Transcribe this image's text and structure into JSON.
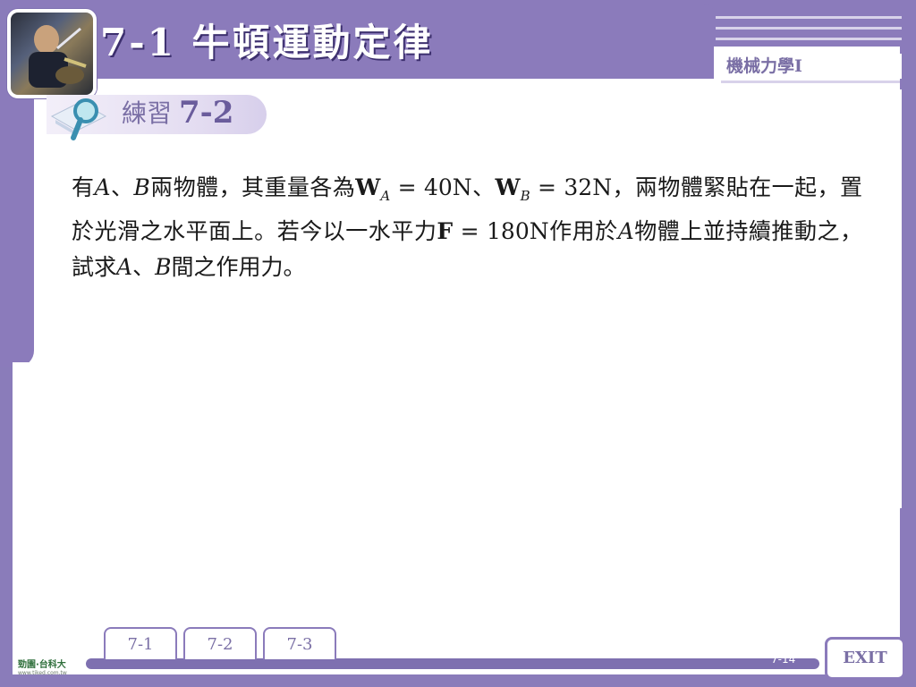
{
  "header": {
    "title": "7-1  牛頓運動定律",
    "course": "機械力學I"
  },
  "practice": {
    "label": "練習",
    "number": "7-2"
  },
  "problem": {
    "line1_start": "有",
    "obj_a": "A",
    "sep1": "、",
    "obj_b": "B",
    "line1_mid": "兩物體，其重量各為",
    "w_symbol": "W",
    "w_sub_a": "A",
    "w_a_value": " = 40N、",
    "w_sub_b": "B",
    "w_b_value": " = 32N，兩物體緊貼在一起，置於光滑之水平面上。若今以一水平力",
    "f_symbol": "F",
    "f_value": " = 180N作用於",
    "obj_a2": "A",
    "line2_end": "物體上並持續推動之，試求",
    "obj_a3": "A",
    "sep2": "、",
    "obj_b3": "B",
    "line3_end": "間之作用力。"
  },
  "nav": {
    "tabs": [
      "7-1",
      "7-2",
      "7-3"
    ],
    "exit_label": "EXIT",
    "page_number": "7-14"
  },
  "footer": {
    "logo_text": "勁園·台科大",
    "logo_url": "www.tiked.com.tw"
  },
  "colors": {
    "frame": "#8b7bbb",
    "accent_text": "#7a6fa5",
    "body_text": "#1a1a1a"
  }
}
